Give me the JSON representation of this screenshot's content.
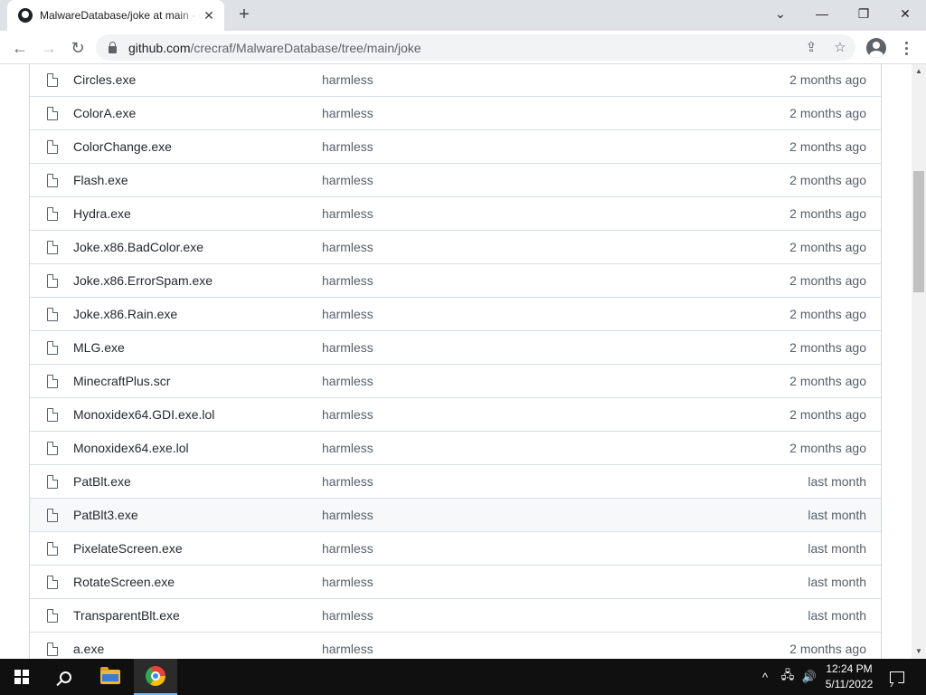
{
  "browser": {
    "tab_title": "MalwareDatabase/joke at main · crecraf/MalwareDatabase",
    "tab_close_glyph": "✕",
    "new_tab_glyph": "+",
    "url_host": "github.com",
    "url_path": "/crecraf/MalwareDatabase/tree/main/joke",
    "window_controls": {
      "dropdown": "⌄",
      "minimize": "—",
      "maximize": "❐",
      "close": "✕"
    },
    "nav_glyphs": {
      "back": "←",
      "forward": "→",
      "reload": "↻"
    }
  },
  "files": [
    {
      "name": "Circles.exe",
      "message": "harmless",
      "age": "2 months ago"
    },
    {
      "name": "ColorA.exe",
      "message": "harmless",
      "age": "2 months ago"
    },
    {
      "name": "ColorChange.exe",
      "message": "harmless",
      "age": "2 months ago"
    },
    {
      "name": "Flash.exe",
      "message": "harmless",
      "age": "2 months ago"
    },
    {
      "name": "Hydra.exe",
      "message": "harmless",
      "age": "2 months ago"
    },
    {
      "name": "Joke.x86.BadColor.exe",
      "message": "harmless",
      "age": "2 months ago"
    },
    {
      "name": "Joke.x86.ErrorSpam.exe",
      "message": "harmless",
      "age": "2 months ago"
    },
    {
      "name": "Joke.x86.Rain.exe",
      "message": "harmless",
      "age": "2 months ago"
    },
    {
      "name": "MLG.exe",
      "message": "harmless",
      "age": "2 months ago"
    },
    {
      "name": "MinecraftPlus.scr",
      "message": "harmless",
      "age": "2 months ago"
    },
    {
      "name": "Monoxidex64.GDI.exe.lol",
      "message": "harmless",
      "age": "2 months ago"
    },
    {
      "name": "Monoxidex64.exe.lol",
      "message": "harmless",
      "age": "2 months ago"
    },
    {
      "name": "PatBlt.exe",
      "message": "harmless",
      "age": "last month"
    },
    {
      "name": "PatBlt3.exe",
      "message": "harmless",
      "age": "last month"
    },
    {
      "name": "PixelateScreen.exe",
      "message": "harmless",
      "age": "last month"
    },
    {
      "name": "RotateScreen.exe",
      "message": "harmless",
      "age": "last month"
    },
    {
      "name": "TransparentBlt.exe",
      "message": "harmless",
      "age": "last month"
    },
    {
      "name": "a.exe",
      "message": "harmless",
      "age": "2 months ago"
    }
  ],
  "hovered_row_index": 13,
  "taskbar": {
    "time": "12:24 PM",
    "date": "5/11/2022",
    "tray_chevron": "^",
    "volume_glyph": "🔊"
  },
  "colors": {
    "tab_strip": "#dee1e6",
    "taskbar": "#101010",
    "row_hover": "#f6f8fa",
    "border": "#d0d7de"
  }
}
